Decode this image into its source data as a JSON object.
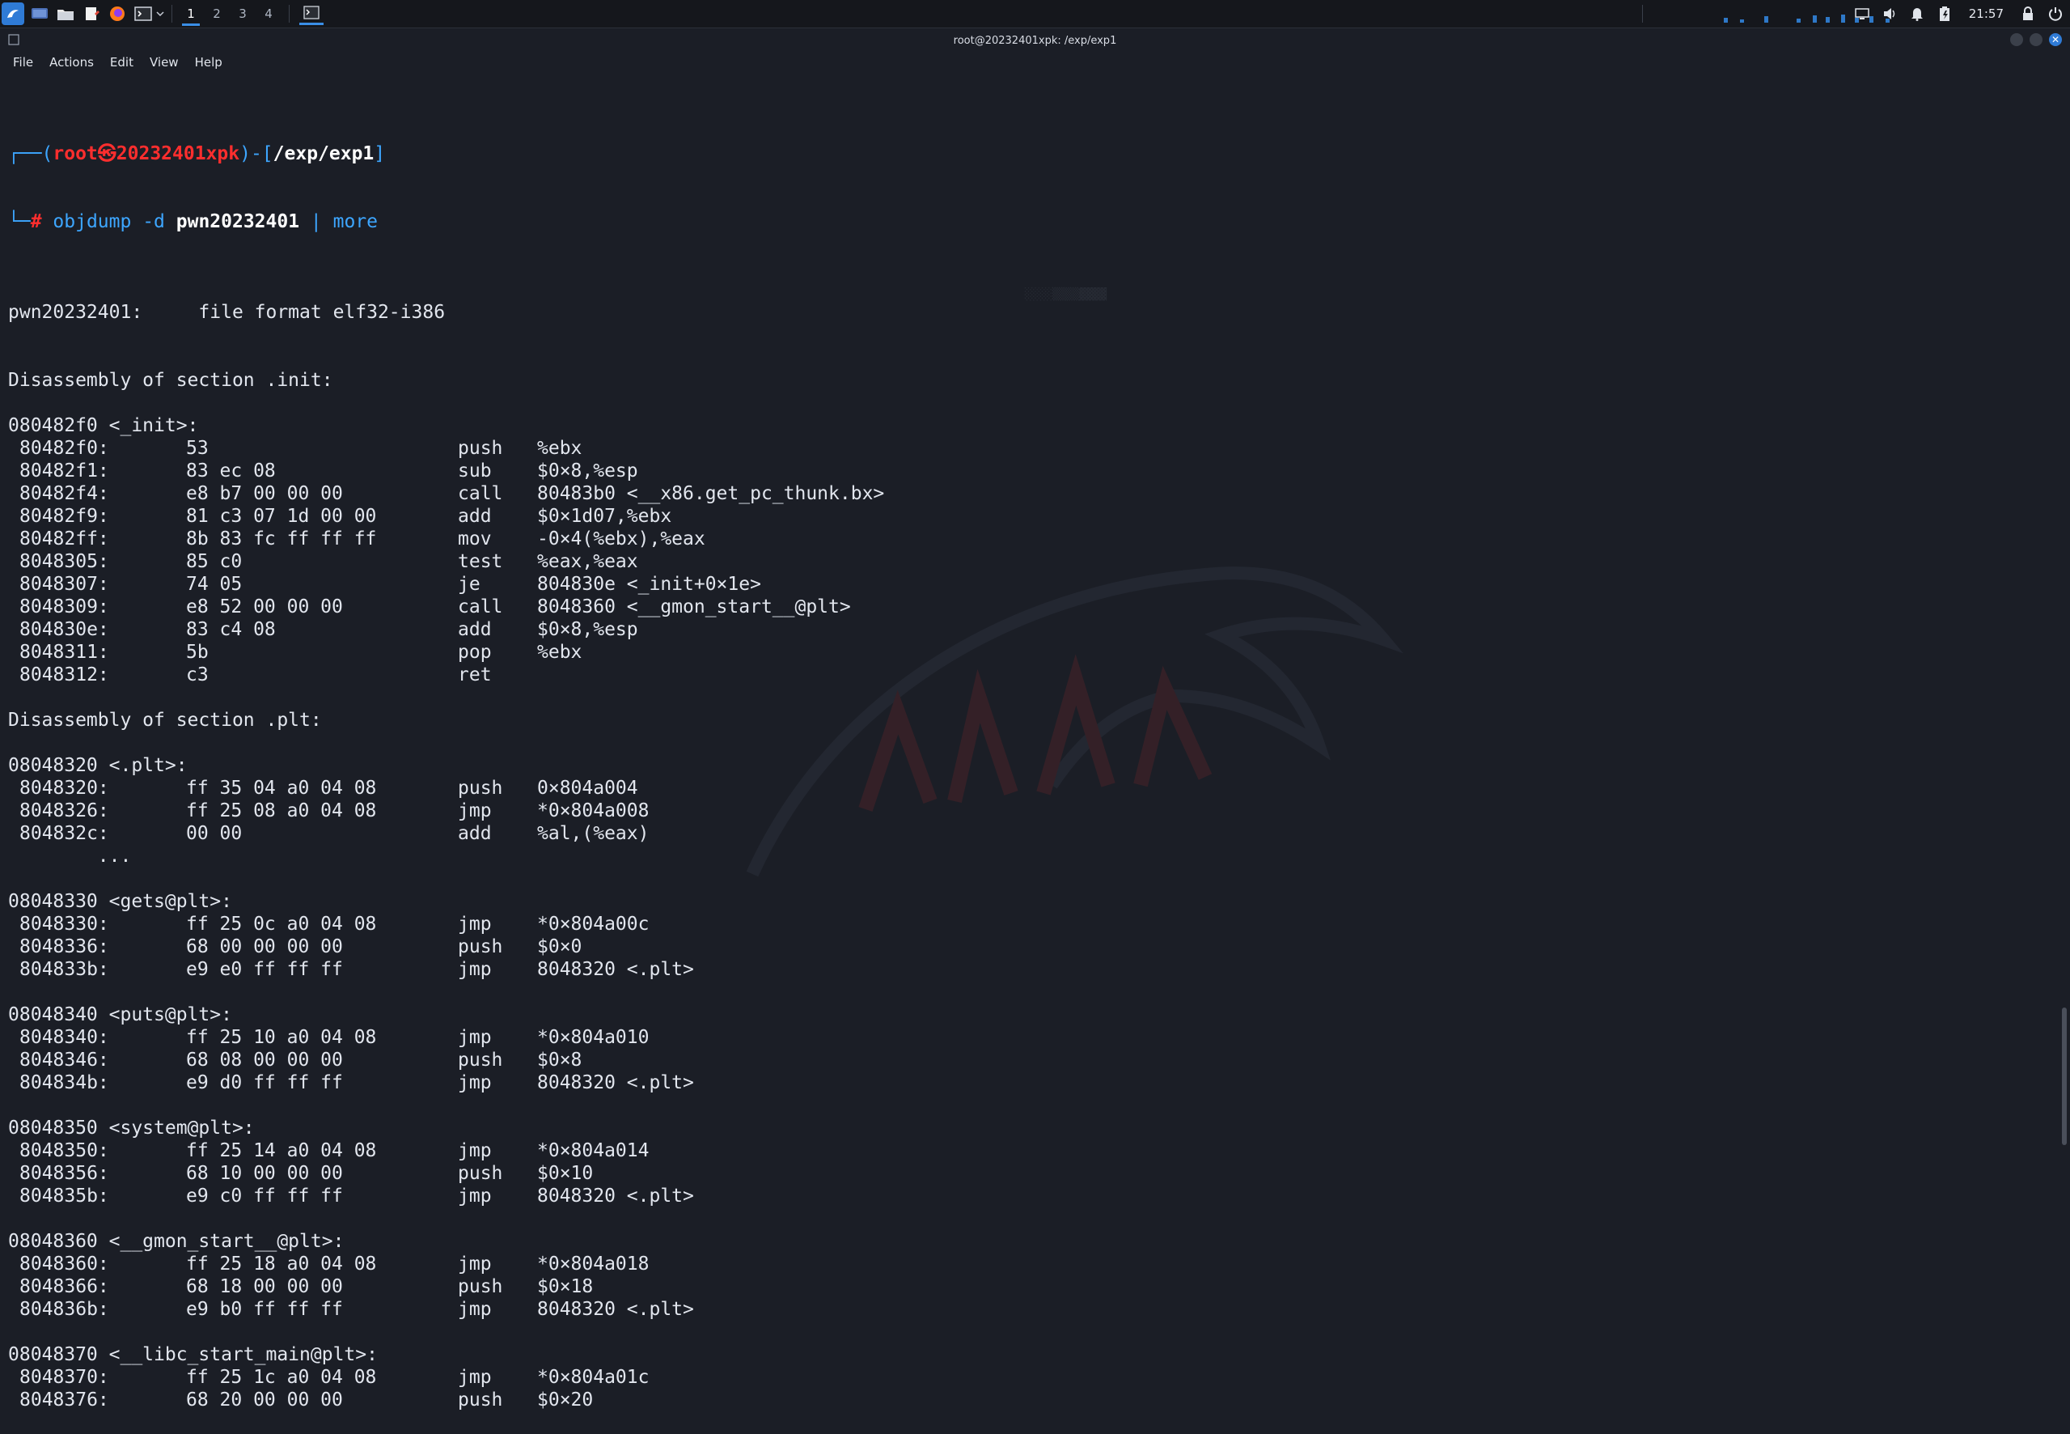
{
  "panel": {
    "workspaces": [
      "1",
      "2",
      "3",
      "4"
    ],
    "clock": "21:57",
    "icons": [
      "kali-menu-icon",
      "desktop-icon",
      "files-icon",
      "text-editor-icon",
      "firefox-icon",
      "terminal-icon"
    ]
  },
  "window": {
    "title": "root@20232401xpk: /exp/exp1"
  },
  "menu": [
    "File",
    "Actions",
    "Edit",
    "View",
    "Help"
  ],
  "prompt": {
    "line1_prefix": "┌──(",
    "user_host": "root㉿20232401xpk",
    "line1_mid": ")-[",
    "path": "/exp/exp1",
    "line1_suffix": "]",
    "line2_prefix": "└─",
    "hash": "#",
    "cmd_a": "objdump -d ",
    "cmd_file": "pwn20232401",
    "cmd_pipe": " | ",
    "cmd_more": "more"
  },
  "terminal_lines": [
    {
      "kind": "blank"
    },
    {
      "kind": "text",
      "text": "pwn20232401:     file format elf32-i386"
    },
    {
      "kind": "blank"
    },
    {
      "kind": "blank"
    },
    {
      "kind": "text",
      "text": "Disassembly of section .init:"
    },
    {
      "kind": "blank"
    },
    {
      "kind": "text",
      "text": "080482f0 <_init>:"
    },
    {
      "kind": "insn",
      "addr": "80482f0:",
      "hex": "53",
      "mn": "push",
      "ops": "%ebx"
    },
    {
      "kind": "insn",
      "addr": "80482f1:",
      "hex": "83 ec 08",
      "mn": "sub",
      "ops": "$0×8,%esp"
    },
    {
      "kind": "insn",
      "addr": "80482f4:",
      "hex": "e8 b7 00 00 00",
      "mn": "call",
      "ops": "80483b0 <__x86.get_pc_thunk.bx>"
    },
    {
      "kind": "insn",
      "addr": "80482f9:",
      "hex": "81 c3 07 1d 00 00",
      "mn": "add",
      "ops": "$0×1d07,%ebx"
    },
    {
      "kind": "insn",
      "addr": "80482ff:",
      "hex": "8b 83 fc ff ff ff",
      "mn": "mov",
      "ops": "-0×4(%ebx),%eax"
    },
    {
      "kind": "insn",
      "addr": "8048305:",
      "hex": "85 c0",
      "mn": "test",
      "ops": "%eax,%eax"
    },
    {
      "kind": "insn",
      "addr": "8048307:",
      "hex": "74 05",
      "mn": "je",
      "ops": "804830e <_init+0×1e>"
    },
    {
      "kind": "insn",
      "addr": "8048309:",
      "hex": "e8 52 00 00 00",
      "mn": "call",
      "ops": "8048360 <__gmon_start__@plt>"
    },
    {
      "kind": "insn",
      "addr": "804830e:",
      "hex": "83 c4 08",
      "mn": "add",
      "ops": "$0×8,%esp"
    },
    {
      "kind": "insn",
      "addr": "8048311:",
      "hex": "5b",
      "mn": "pop",
      "ops": "%ebx"
    },
    {
      "kind": "insn",
      "addr": "8048312:",
      "hex": "c3",
      "mn": "ret",
      "ops": ""
    },
    {
      "kind": "blank"
    },
    {
      "kind": "text",
      "text": "Disassembly of section .plt:"
    },
    {
      "kind": "blank"
    },
    {
      "kind": "text",
      "text": "08048320 <.plt>:"
    },
    {
      "kind": "insn",
      "addr": "8048320:",
      "hex": "ff 35 04 a0 04 08",
      "mn": "push",
      "ops": "0×804a004"
    },
    {
      "kind": "insn",
      "addr": "8048326:",
      "hex": "ff 25 08 a0 04 08",
      "mn": "jmp",
      "ops": "*0×804a008"
    },
    {
      "kind": "insn",
      "addr": "804832c:",
      "hex": "00 00",
      "mn": "add",
      "ops": "%al,(%eax)"
    },
    {
      "kind": "text",
      "text": "        ..."
    },
    {
      "kind": "blank"
    },
    {
      "kind": "text",
      "text": "08048330 <gets@plt>:"
    },
    {
      "kind": "insn",
      "addr": "8048330:",
      "hex": "ff 25 0c a0 04 08",
      "mn": "jmp",
      "ops": "*0×804a00c"
    },
    {
      "kind": "insn",
      "addr": "8048336:",
      "hex": "68 00 00 00 00",
      "mn": "push",
      "ops": "$0×0"
    },
    {
      "kind": "insn",
      "addr": "804833b:",
      "hex": "e9 e0 ff ff ff",
      "mn": "jmp",
      "ops": "8048320 <.plt>"
    },
    {
      "kind": "blank"
    },
    {
      "kind": "text",
      "text": "08048340 <puts@plt>:"
    },
    {
      "kind": "insn",
      "addr": "8048340:",
      "hex": "ff 25 10 a0 04 08",
      "mn": "jmp",
      "ops": "*0×804a010"
    },
    {
      "kind": "insn",
      "addr": "8048346:",
      "hex": "68 08 00 00 00",
      "mn": "push",
      "ops": "$0×8"
    },
    {
      "kind": "insn",
      "addr": "804834b:",
      "hex": "e9 d0 ff ff ff",
      "mn": "jmp",
      "ops": "8048320 <.plt>"
    },
    {
      "kind": "blank"
    },
    {
      "kind": "text",
      "text": "08048350 <system@plt>:"
    },
    {
      "kind": "insn",
      "addr": "8048350:",
      "hex": "ff 25 14 a0 04 08",
      "mn": "jmp",
      "ops": "*0×804a014"
    },
    {
      "kind": "insn",
      "addr": "8048356:",
      "hex": "68 10 00 00 00",
      "mn": "push",
      "ops": "$0×10"
    },
    {
      "kind": "insn",
      "addr": "804835b:",
      "hex": "e9 c0 ff ff ff",
      "mn": "jmp",
      "ops": "8048320 <.plt>"
    },
    {
      "kind": "blank"
    },
    {
      "kind": "text",
      "text": "08048360 <__gmon_start__@plt>:"
    },
    {
      "kind": "insn",
      "addr": "8048360:",
      "hex": "ff 25 18 a0 04 08",
      "mn": "jmp",
      "ops": "*0×804a018"
    },
    {
      "kind": "insn",
      "addr": "8048366:",
      "hex": "68 18 00 00 00",
      "mn": "push",
      "ops": "$0×18"
    },
    {
      "kind": "insn",
      "addr": "804836b:",
      "hex": "e9 b0 ff ff ff",
      "mn": "jmp",
      "ops": "8048320 <.plt>"
    },
    {
      "kind": "blank"
    },
    {
      "kind": "text",
      "text": "08048370 <__libc_start_main@plt>:"
    },
    {
      "kind": "insn",
      "addr": "8048370:",
      "hex": "ff 25 1c a0 04 08",
      "mn": "jmp",
      "ops": "*0×804a01c"
    },
    {
      "kind": "insn",
      "addr": "8048376:",
      "hex": "68 20 00 00 00",
      "mn": "push",
      "ops": "$0×20"
    }
  ],
  "colors": {
    "prompt_frame": "#3da6ff",
    "prompt_user": "#ff2e2e",
    "accent": "#2f7bd6",
    "background": "#1b1e26"
  }
}
